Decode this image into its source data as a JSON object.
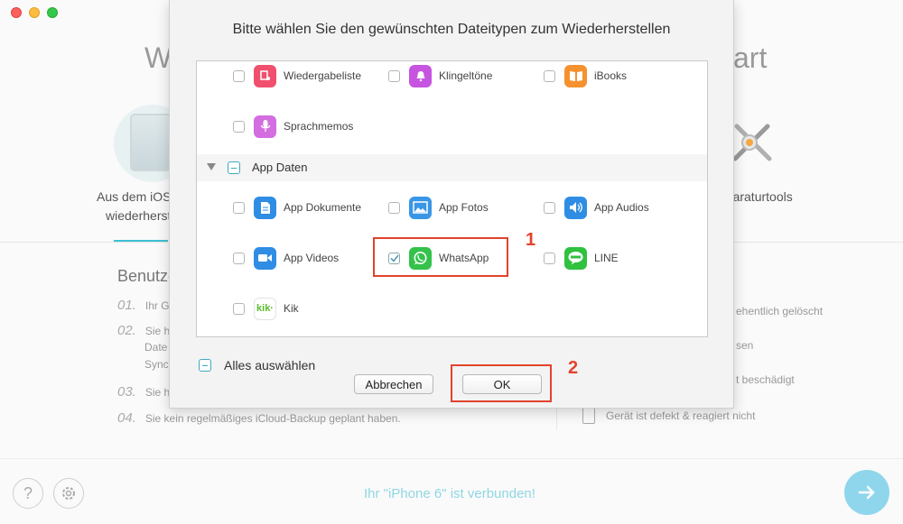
{
  "background": {
    "title_left": "W",
    "title_right": "art",
    "option_left_line1": "Aus dem iOS",
    "option_left_line2": "wiederherst",
    "option_right": "eparaturtools",
    "heading": "Benutze",
    "steps": [
      {
        "num": "01.",
        "text": "Ihr G"
      },
      {
        "num": "02.",
        "text": "Sie h"
      },
      {
        "num": "",
        "text": "Date"
      },
      {
        "num": "",
        "text": "Sync"
      },
      {
        "num": "03.",
        "text": "Sie h"
      },
      {
        "num": "04.",
        "text": "Sie kein regelmäßiges iCloud-Backup geplant haben."
      }
    ],
    "right_items": [
      "ehentlich gelöscht",
      "sen",
      "t beschädigt",
      "Gerät ist defekt & reagiert nicht"
    ],
    "status": "Ihr \"iPhone 6\" ist verbunden!",
    "help_symbol": "?"
  },
  "modal": {
    "title": "Bitte wählen Sie den gewünschten Dateitypen zum Wiederherstellen",
    "items_top": [
      {
        "label": "Wiedergabeliste",
        "icon": "playlist-icon",
        "checked": false,
        "color": "#f0506e"
      },
      {
        "label": "Klingeltöne",
        "icon": "bell-icon",
        "checked": false,
        "color": "#c654e0"
      },
      {
        "label": "iBooks",
        "icon": "book-icon",
        "checked": false,
        "color": "#f5922f"
      },
      {
        "label": "Sprachmemos",
        "icon": "microphone-icon",
        "checked": false,
        "color": "#d36de0"
      }
    ],
    "section": {
      "label": "App Daten"
    },
    "items_app": [
      {
        "label": "App Dokumente",
        "icon": "document-icon",
        "checked": false,
        "color": "#2f8de4"
      },
      {
        "label": "App Fotos",
        "icon": "photo-icon",
        "checked": false,
        "color": "#3a96e6"
      },
      {
        "label": "App Audios",
        "icon": "speaker-icon",
        "checked": false,
        "color": "#2f8de4"
      },
      {
        "label": "App Videos",
        "icon": "video-camera-icon",
        "checked": false,
        "color": "#2f8de4"
      },
      {
        "label": "WhatsApp",
        "icon": "whatsapp-icon",
        "checked": true,
        "color": "#34c24a"
      },
      {
        "label": "LINE",
        "icon": "line-icon",
        "checked": false,
        "color": "#2fc13f"
      },
      {
        "label": "Kik",
        "icon": "kik-icon",
        "checked": false,
        "color": "#5bbd2b",
        "text": "kik·"
      }
    ],
    "select_all_label": "Alles auswählen",
    "cancel_label": "Abbrechen",
    "ok_label": "OK"
  },
  "annotations": {
    "step1": "1",
    "step2": "2"
  },
  "colors": {
    "accent": "#3fbfd6",
    "highlight": "#e2432e"
  }
}
